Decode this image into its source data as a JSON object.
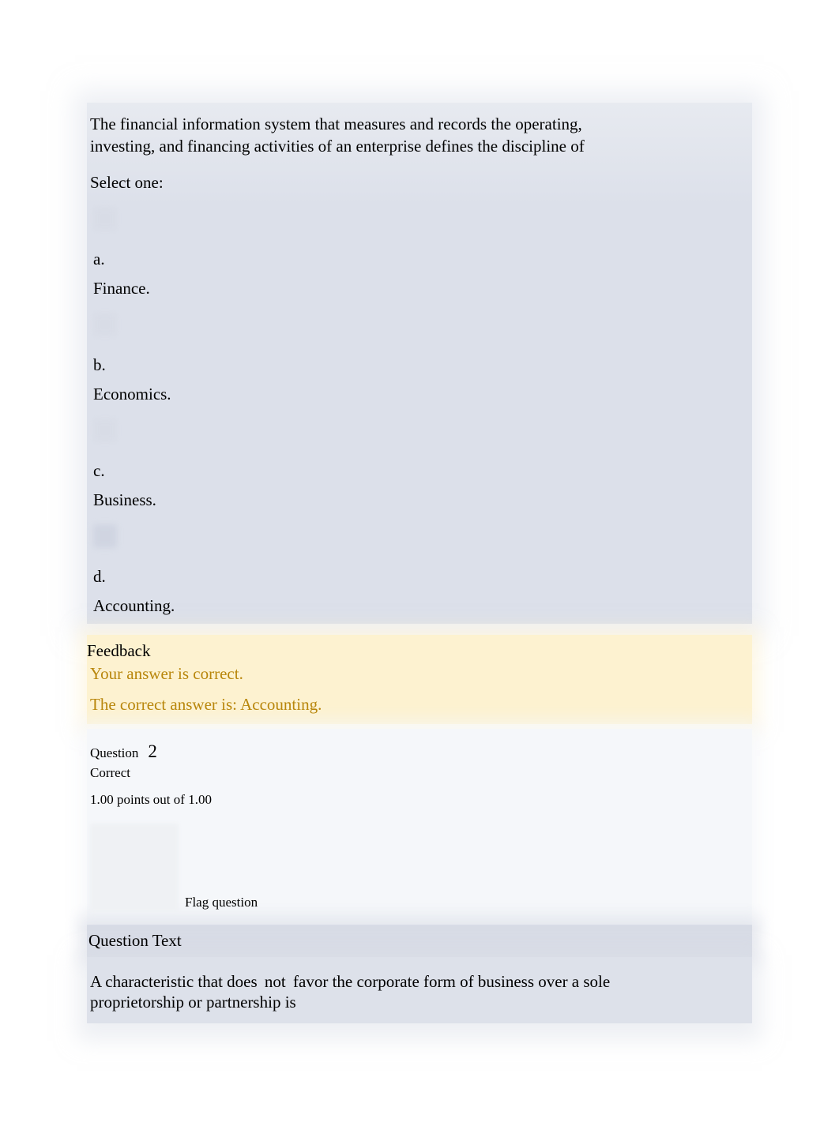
{
  "q1": {
    "text_line1": "The financial information system that measures and records the operating,",
    "text_line2": "investing, and financing activities of an enterprise defines the discipline of",
    "select_one": "Select one:",
    "options": [
      {
        "label": "a.",
        "text": "Finance."
      },
      {
        "label": "b.",
        "text": "Economics."
      },
      {
        "label": "c.",
        "text": "Business."
      },
      {
        "label": "d.",
        "text": "Accounting."
      }
    ]
  },
  "feedback": {
    "heading": "Feedback",
    "correct_line": "Your answer is correct.",
    "answer_line": "The correct answer is: Accounting."
  },
  "q2": {
    "question_word": "Question",
    "number": "2",
    "status": "Correct",
    "points": "1.00 points out of 1.00",
    "flag_label": "Flag question",
    "text_heading": "Question Text",
    "body_part1": "A characteristic that does",
    "body_not": "not",
    "body_part2": "favor the corporate form of business over a sole",
    "body_part3": "proprietorship or partnership is"
  }
}
